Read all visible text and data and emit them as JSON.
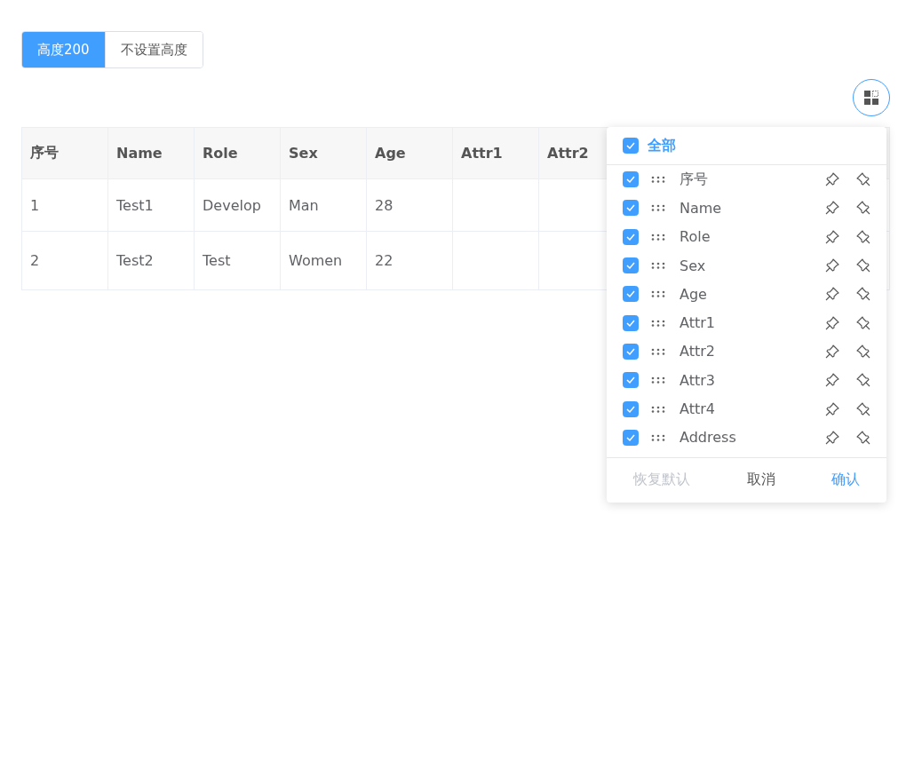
{
  "height_toggle": [
    {
      "label": "高度200",
      "selected": true
    },
    {
      "label": "不设置高度",
      "selected": false
    }
  ],
  "table": {
    "columns": [
      "序号",
      "Name",
      "Role",
      "Sex",
      "Age",
      "Attr1",
      "Attr2"
    ],
    "rows": [
      [
        "1",
        "Test1",
        "Develop",
        "Man",
        "28",
        "",
        ""
      ],
      [
        "2",
        "Test2",
        "Test",
        "Women",
        "22",
        "",
        ""
      ]
    ]
  },
  "column_panel": {
    "select_all": {
      "label": "全部",
      "checked": true
    },
    "items": [
      {
        "label": "序号",
        "checked": true
      },
      {
        "label": "Name",
        "checked": true
      },
      {
        "label": "Role",
        "checked": true
      },
      {
        "label": "Sex",
        "checked": true
      },
      {
        "label": "Age",
        "checked": true
      },
      {
        "label": "Attr1",
        "checked": true
      },
      {
        "label": "Attr2",
        "checked": true
      },
      {
        "label": "Attr3",
        "checked": true
      },
      {
        "label": "Attr4",
        "checked": true
      },
      {
        "label": "Address",
        "checked": true
      }
    ],
    "buttons": [
      {
        "label": "恢复默认",
        "kind": "reset",
        "disabled": true
      },
      {
        "label": "取消",
        "kind": "cancel",
        "disabled": false
      },
      {
        "label": "确认",
        "kind": "confirm",
        "disabled": false
      }
    ]
  }
}
